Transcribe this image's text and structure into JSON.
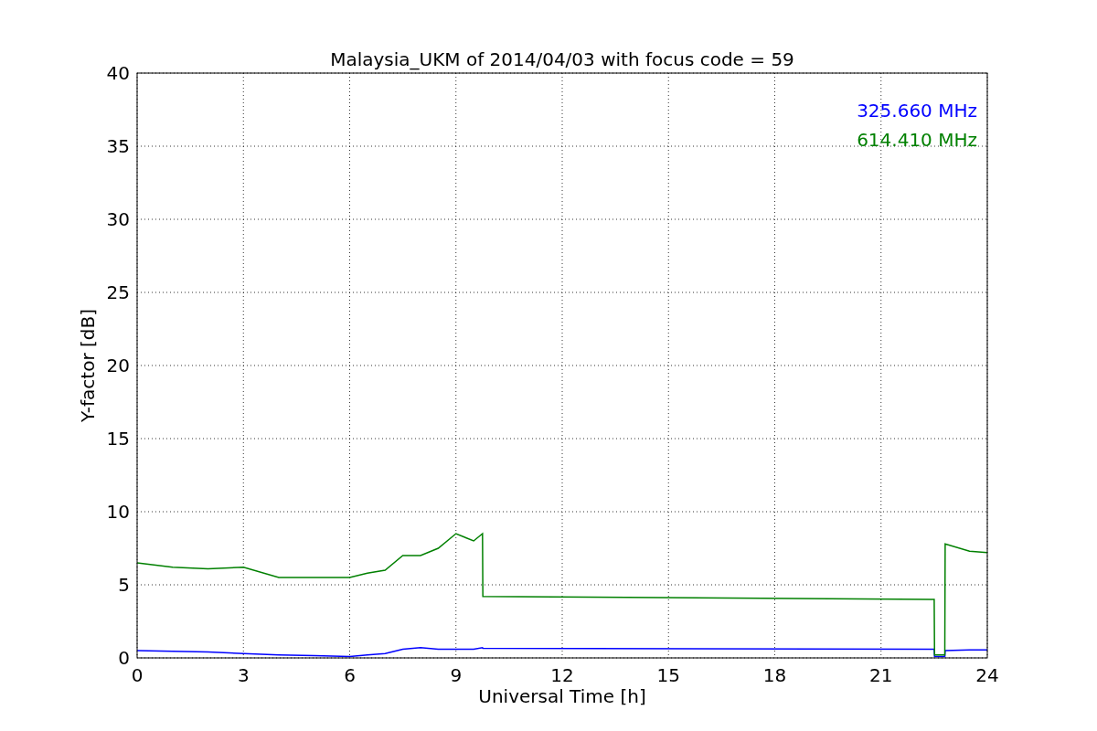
{
  "chart_data": {
    "type": "line",
    "title": "Malaysia_UKM of 2014/04/03 with focus code = 59",
    "xlabel": "Universal Time [h]",
    "ylabel": "Y-factor [dB]",
    "x": [
      0,
      1,
      2,
      3,
      4,
      5,
      6,
      6.5,
      7,
      7.5,
      8,
      8.5,
      9,
      9.5,
      9.75,
      9.76,
      22.5,
      22.51,
      22.8,
      22.81,
      23.5,
      24
    ],
    "series": [
      {
        "name": "325.660 MHz",
        "color": "#0000ff",
        "values": [
          0.5,
          0.45,
          0.4,
          0.3,
          0.2,
          0.15,
          0.1,
          0.2,
          0.3,
          0.6,
          0.7,
          0.6,
          0.6,
          0.6,
          0.7,
          0.65,
          0.6,
          0.1,
          0.1,
          0.5,
          0.55,
          0.55
        ]
      },
      {
        "name": "614.410 MHz",
        "color": "#008000",
        "values": [
          6.5,
          6.2,
          6.1,
          6.2,
          5.5,
          5.5,
          5.5,
          5.8,
          6,
          7,
          7,
          7.5,
          8.5,
          8,
          8.5,
          4.2,
          4.0,
          0.2,
          0.2,
          7.8,
          7.3,
          7.2
        ]
      }
    ],
    "xlim": [
      0,
      24
    ],
    "ylim": [
      0,
      40
    ],
    "xticks": [
      0,
      3,
      6,
      9,
      12,
      15,
      18,
      21,
      24
    ],
    "yticks": [
      0,
      5,
      10,
      15,
      20,
      25,
      30,
      35,
      40
    ],
    "grid": true
  }
}
